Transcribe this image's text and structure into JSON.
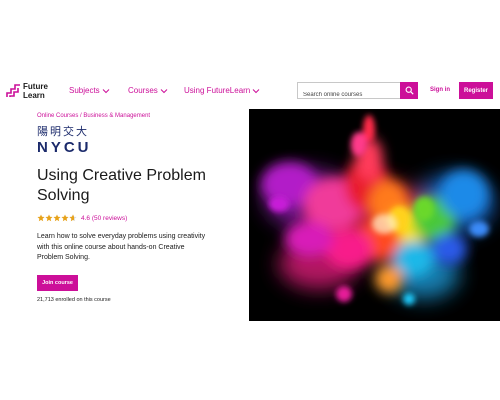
{
  "nav": {
    "logo_text": "Future Learn",
    "links": [
      {
        "label": "Subjects"
      },
      {
        "label": "Courses"
      },
      {
        "label": "Using FutureLearn"
      }
    ],
    "search_placeholder": "Search online courses",
    "signin_label": "Sign in",
    "register_label": "Register"
  },
  "hero": {
    "breadcrumb": [
      "Online Courses",
      "Business & Management"
    ],
    "breadcrumb_separator": "/",
    "university_cn": "陽明交大",
    "university_en": "NYCU",
    "title": "Using Creative Problem Solving",
    "rating_value": 4.6,
    "rating_text": "4.6 (50 reviews)",
    "description": "Learn how to solve everyday problems using creativity with this online course about hands-on Creative Problem Solving.",
    "join_label": "Join course",
    "enrolled_text": "21,713 enrolled on this course"
  },
  "colors": {
    "brand": "#cc0f99",
    "star": "#e7a21a",
    "uni": "#1b2a6b"
  }
}
